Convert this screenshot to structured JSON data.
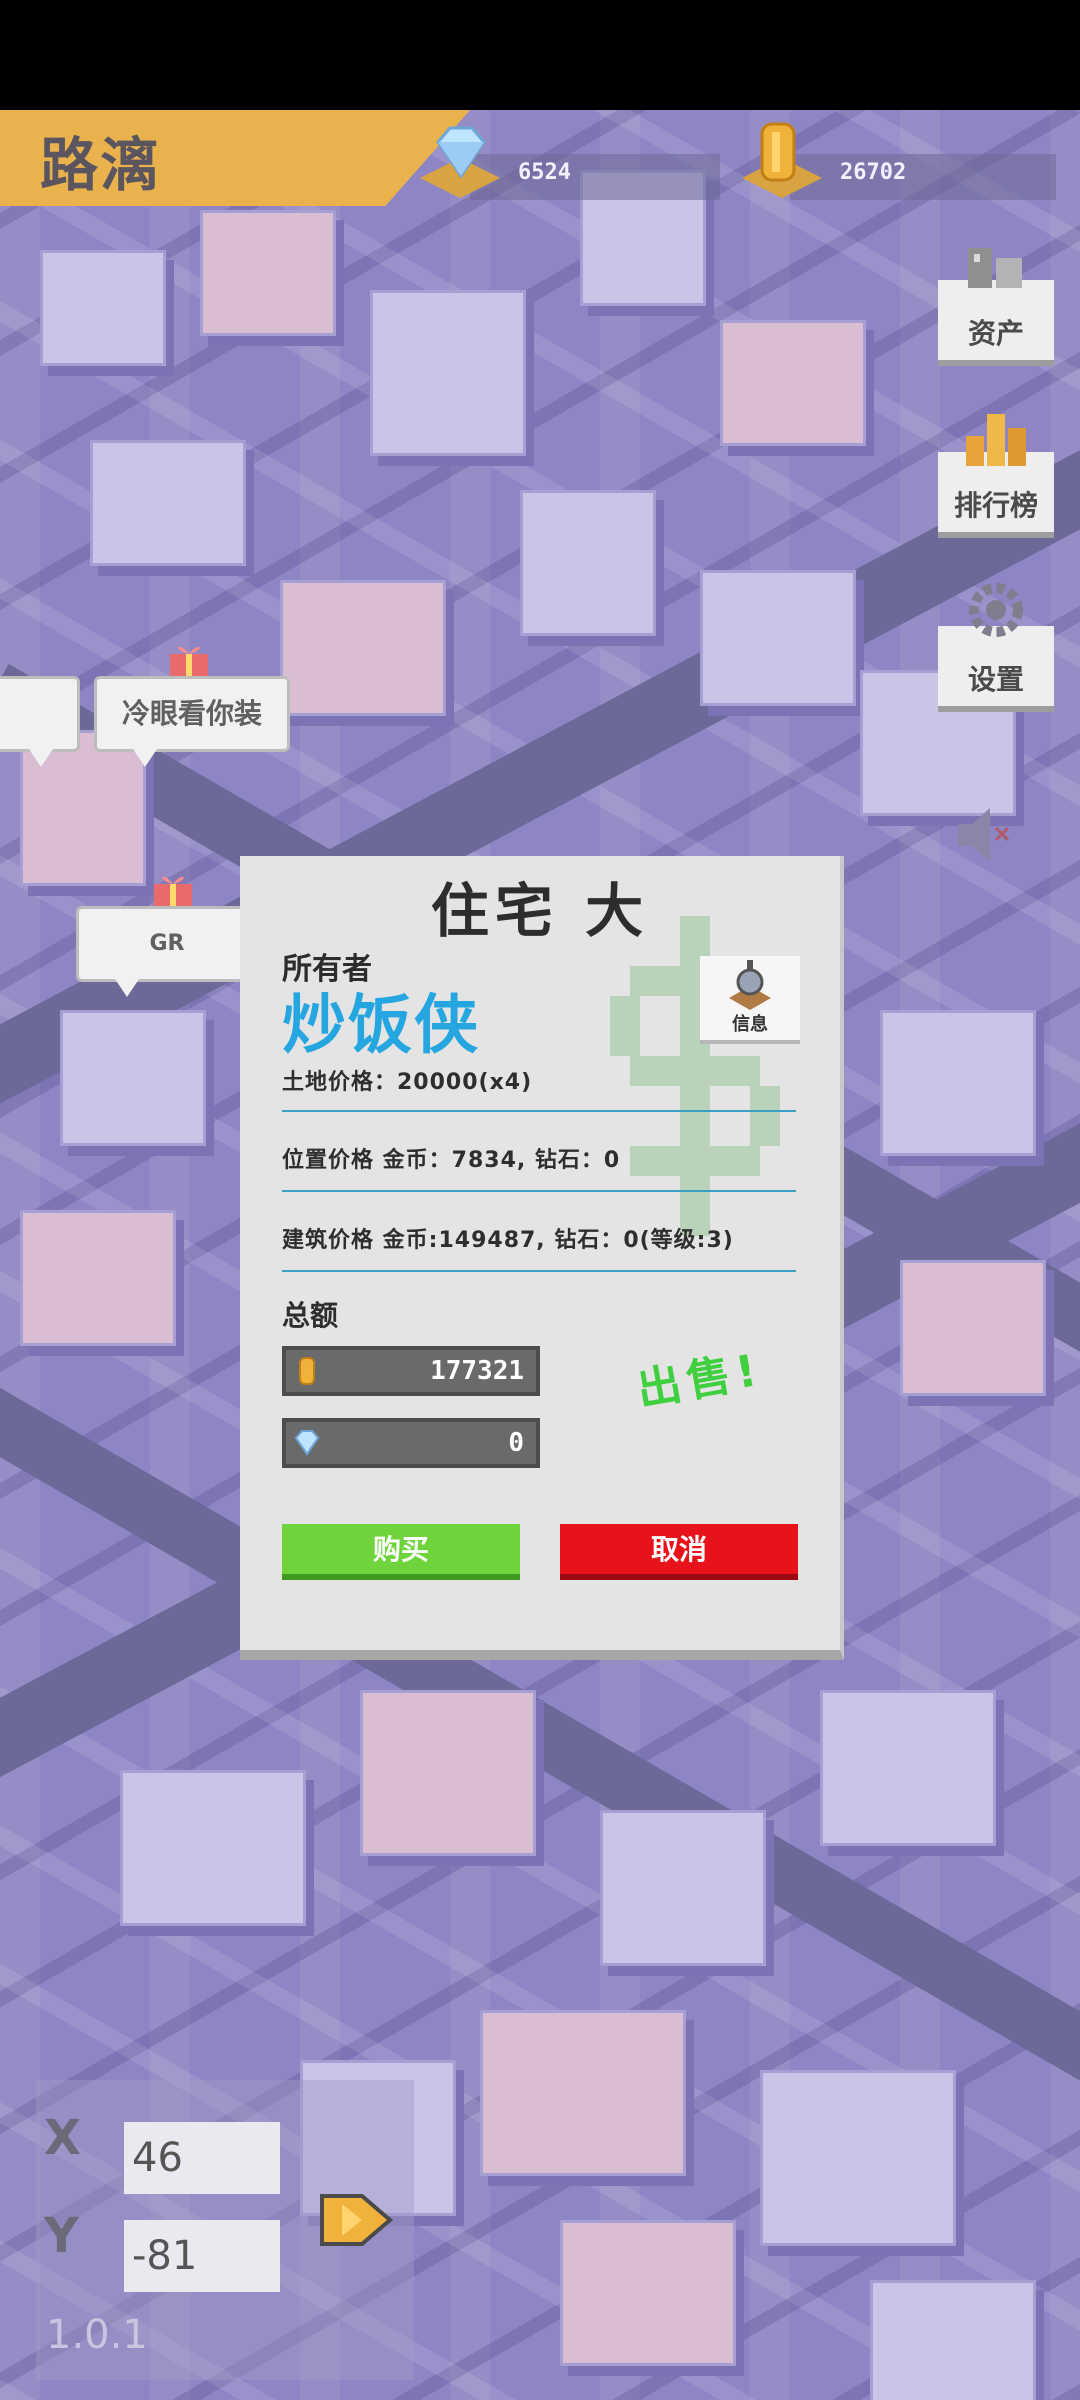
{
  "player": {
    "name": "路漓"
  },
  "resources": {
    "diamonds": "6524",
    "coins": "26702"
  },
  "side_menu": [
    {
      "label": "资产",
      "icon": "assets-icon"
    },
    {
      "label": "排行榜",
      "icon": "leaderboard-icon"
    },
    {
      "label": "设置",
      "icon": "settings-icon"
    }
  ],
  "bubbles": {
    "left_partial": "",
    "bubble1": "冷眼看你装",
    "bubble2": "GR"
  },
  "dialog": {
    "title": "住宅 大",
    "owner_label": "所有者",
    "owner_name": "炒饭侠",
    "info_label": "信息",
    "land_price": "土地价格：20000(x4)",
    "location_price": "位置价格 金币：7834, 钻石：0",
    "building_price": "建筑价格 金币:149487, 钻石：0(等级:3)",
    "total_label": "总额",
    "total_coins": "177321",
    "total_diamonds": "0",
    "sell_text": "出售!",
    "buy_label": "购买",
    "cancel_label": "取消"
  },
  "coords": {
    "x_label": "X",
    "y_label": "Y",
    "x_value": "46",
    "y_value": "-81"
  },
  "version": "1.0.1",
  "colors": {
    "banner": "#e9b24d",
    "owner_name": "#25a6e0",
    "buy": "#6fd43b",
    "cancel": "#e8121b",
    "sell": "#3fcf3f"
  }
}
